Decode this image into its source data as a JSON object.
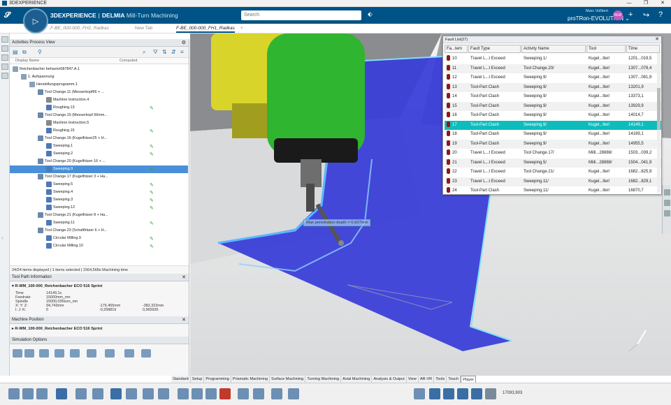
{
  "window": {
    "title": "3DEXPERIENCE",
    "controls": [
      "—",
      "❐",
      "✕"
    ]
  },
  "brand": {
    "prefix": "3D",
    "main": "EXPERIENCE",
    "sep": "|",
    "company": "DELMIA",
    "app": "Mill-Turn Machining"
  },
  "search": {
    "placeholder": "Search"
  },
  "user": {
    "name": "proTRon-EVOLUTION ⌄",
    "subtitle": "Marc Vollbert",
    "avatar": "NGB"
  },
  "tabs": [
    {
      "label": "F-BE_000-000_FH2_Radkas"
    },
    {
      "label": "New Tab"
    },
    {
      "label": "F-BE_000-000_FH1_Radkas"
    },
    {
      "label": "+"
    }
  ],
  "process_panel": {
    "title": "Activities Process View",
    "col_display": "Display Name",
    "col_computed": "Computed",
    "rows": [
      {
        "label": "Reichenbacher behavior087847.A.1",
        "indent": 0
      },
      {
        "label": "1. Aufspannung",
        "indent": 1
      },
      {
        "label": "Herstellungsprogramm.1",
        "indent": 2
      },
      {
        "label": "Tool Change.11 (Messerkopf66 + ...",
        "indent": 3
      },
      {
        "label": "Machine Instruction.4",
        "indent": 4
      },
      {
        "label": "Roughing.13",
        "indent": 4,
        "check": true
      },
      {
        "label": "Tool Change.15 (Messerkopf 66mm...",
        "indent": 3
      },
      {
        "label": "Machine Instruction.5",
        "indent": 4
      },
      {
        "label": "Roughing.15",
        "indent": 4,
        "check": true
      },
      {
        "label": "Tool Change.16 (Kugelfräser25 + H...",
        "indent": 3
      },
      {
        "label": "Sweeping.1",
        "indent": 4,
        "check": true
      },
      {
        "label": "Sweeping.2",
        "indent": 4,
        "check": true
      },
      {
        "label": "Tool Change.20 (Kugelfräser 16 + ...",
        "indent": 3
      },
      {
        "label": "Sweeping.9",
        "indent": 4,
        "check": true,
        "selected": true
      },
      {
        "label": "Tool Change.17 (Kugelfräser 3 + Ha...",
        "indent": 3
      },
      {
        "label": "Sweeping.5",
        "indent": 4,
        "check": true
      },
      {
        "label": "Sweeping.4",
        "indent": 4,
        "check": true
      },
      {
        "label": "Sweeping.3",
        "indent": 4,
        "check": true
      },
      {
        "label": "Sweeping.12",
        "indent": 4,
        "check": true
      },
      {
        "label": "Tool Change.21 (Kugelfräser 8 + Ha...",
        "indent": 3
      },
      {
        "label": "Sweeping.11",
        "indent": 4,
        "check": true
      },
      {
        "label": "Tool Change.23 (Schaftfräser 6 + H...",
        "indent": 3
      },
      {
        "label": "Circular Milling.9",
        "indent": 4,
        "check": true
      },
      {
        "label": "Circular Milling.10",
        "indent": 4,
        "check": true
      }
    ],
    "status": "24/24 items displayed | 1 items selected | 1564,568s Machining time"
  },
  "tool_path": {
    "title": "Tool Path Information",
    "machine": "R-WM_100-000_Reichenbacher ECO 516 Sprint",
    "fields": [
      {
        "k": "Time",
        "a": "14149,1s",
        "b": "",
        "c": ""
      },
      {
        "k": "Feedrate",
        "a": "15000mm_mn",
        "b": "",
        "c": ""
      },
      {
        "k": "Spindle",
        "a": "15000,035turn_mn",
        "b": "",
        "c": ""
      },
      {
        "k": "X: Y: Z:",
        "a": "94,743mm",
        "b": "-176,455mm",
        "c": "-382,322mm"
      },
      {
        "k": "I: J: K:",
        "a": "0",
        "b": "-0,258819",
        "c": "0,965926"
      }
    ]
  },
  "machine_position": {
    "title": "Machine Position",
    "machine": "R-WM_100-000_Reichenbacher ECO 516 Sprint"
  },
  "sim_options": {
    "title": "Simulation Options"
  },
  "fault_list": {
    "title": "Fault List(27)",
    "columns": [
      "Fa...tem",
      "Fault Type",
      "Activity Name",
      "Tool",
      "Time"
    ],
    "rows": [
      {
        "n": "10",
        "type": "Travel L...t Exceed",
        "act": "Sweeping.1/",
        "tool": "Kugel...lter/",
        "time": "1201...019,5"
      },
      {
        "n": "11",
        "type": "Travel L...t Exceed",
        "act": "Tool Change.20/",
        "tool": "Kugel...lter/",
        "time": "1307...078,4"
      },
      {
        "n": "12",
        "type": "Travel L...t Exceed",
        "act": "Sweeping.9/",
        "tool": "Kugel...lter/",
        "time": "1307...081,9"
      },
      {
        "n": "13",
        "type": "Tool-Part Clash",
        "act": "Sweeping.9/",
        "tool": "Kugel...lter/",
        "time": "13201,9"
      },
      {
        "n": "14",
        "type": "Tool-Part Clash",
        "act": "Sweeping.9/",
        "tool": "Kugel...lter/",
        "time": "13373,1"
      },
      {
        "n": "15",
        "type": "Tool-Part Clash",
        "act": "Sweeping.9/",
        "tool": "Kugel...lter/",
        "time": "13929,9"
      },
      {
        "n": "16",
        "type": "Tool-Part Clash",
        "act": "Sweeping.9/",
        "tool": "Kugel...lter/",
        "time": "14014,7"
      },
      {
        "n": "17",
        "type": "Tool-Part Clash",
        "act": "Sweeping.9/",
        "tool": "Kugel...lter/",
        "time": "14149,1"
      },
      {
        "n": "18",
        "type": "Tool-Part Clash",
        "act": "Sweeping.9/",
        "tool": "Kugel...lter/",
        "time": "14189,1"
      },
      {
        "n": "19",
        "type": "Tool-Part Clash",
        "act": "Sweeping.9/",
        "tool": "Kugel...lter/",
        "time": "14955,5"
      },
      {
        "n": "20",
        "type": "Travel L...t Exceed",
        "act": "Tool Change.17/",
        "tool": "Milli...28888/",
        "time": "1503...039,2"
      },
      {
        "n": "21",
        "type": "Travel L...t Exceed",
        "act": "Sweeping.5/",
        "tool": "Milli...28888/",
        "time": "1504...041,9"
      },
      {
        "n": "22",
        "type": "Travel L...t Exceed",
        "act": "Tool Change.21/",
        "tool": "Kugel...lter/",
        "time": "1682...825,9"
      },
      {
        "n": "23",
        "type": "Travel L...t Exceed",
        "act": "Sweeping.11/",
        "tool": "Kugel...lter/",
        "time": "1682...829,1"
      },
      {
        "n": "24",
        "type": "Tool-Part Clash",
        "act": "Sweeping.11/",
        "tool": "Kugel...lter/",
        "time": "16870,7"
      }
    ]
  },
  "measure": {
    "label": "Max penetration depth = 0,607mm"
  },
  "bottom_tabs": [
    "Standard",
    "Setup",
    "Programming",
    "Prismatic Machining",
    "Surface Machining",
    "Turning Machining",
    "Axial Machining",
    "Analysis & Output",
    "View",
    "AR-VR",
    "Tools",
    "Touch",
    "Player"
  ],
  "active_bottom_tab": "Player",
  "player": {
    "time": "17093,903"
  },
  "colors": {
    "topbar": "#005386",
    "fault_highlight": "#0fbcbc",
    "selection": "#4a90d9",
    "part": "#3b3fd8",
    "machine_green": "#2fb52f",
    "machine_yellow": "#d9d42a"
  }
}
